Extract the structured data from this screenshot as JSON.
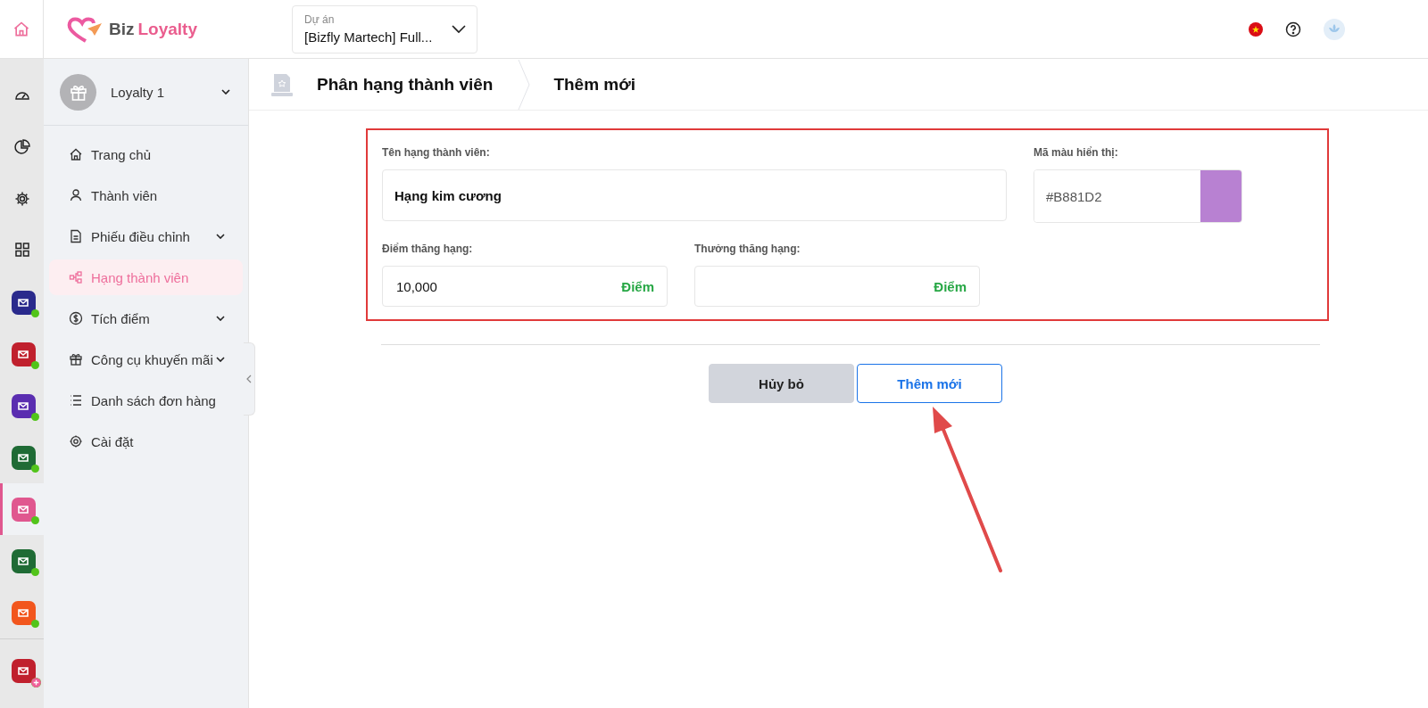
{
  "header": {
    "logo": {
      "part_1": "Biz",
      "part_2": "Loyalty"
    },
    "project": {
      "label": "Dự án",
      "value": "[Bizfly Martech] Full..."
    }
  },
  "rail": {
    "apps": [
      {
        "color": "#2a2a8c",
        "selected": false,
        "online": true
      },
      {
        "color": "#c0202d",
        "selected": false,
        "online": true
      },
      {
        "color": "#5a2db0",
        "selected": false,
        "online": true
      },
      {
        "color": "#1f6b35",
        "selected": false,
        "online": true
      },
      {
        "color": "#e0578f",
        "selected": true,
        "online": true
      },
      {
        "color": "#1f6b35",
        "selected": false,
        "online": true
      },
      {
        "color": "#f2561d",
        "selected": false,
        "online": true
      }
    ],
    "bottom_app": {
      "color": "#c0202d",
      "add_badge": true
    }
  },
  "sidebar": {
    "account": "Loyalty 1",
    "items": [
      {
        "label": "Trang chủ",
        "selected": false,
        "has_submenu": false
      },
      {
        "label": "Thành viên",
        "selected": false,
        "has_submenu": false
      },
      {
        "label": "Phiếu điều chỉnh",
        "selected": false,
        "has_submenu": true
      },
      {
        "label": "Hạng thành viên",
        "selected": true,
        "has_submenu": false
      },
      {
        "label": "Tích điểm",
        "selected": false,
        "has_submenu": true
      },
      {
        "label": "Công cụ khuyến mãi",
        "selected": false,
        "has_submenu": true
      },
      {
        "label": "Danh sách đơn hàng",
        "selected": false,
        "has_submenu": false
      },
      {
        "label": "Cài đặt",
        "selected": false,
        "has_submenu": false
      }
    ]
  },
  "breadcrumb": [
    "Phân hạng thành viên",
    "Thêm mới"
  ],
  "form": {
    "name": {
      "label": "Tên hạng thành viên:",
      "value": "Hạng kim cương"
    },
    "color": {
      "label": "Mã màu hiển thị:",
      "value": "#B881D2"
    },
    "points": {
      "label": "Điểm thăng hạng:",
      "value": "10,000",
      "unit": "Điểm"
    },
    "reward": {
      "label": "Thưởng thăng hạng:",
      "unit": "Điểm"
    }
  },
  "buttons": {
    "cancel": "Hủy bỏ",
    "submit": "Thêm mới"
  }
}
